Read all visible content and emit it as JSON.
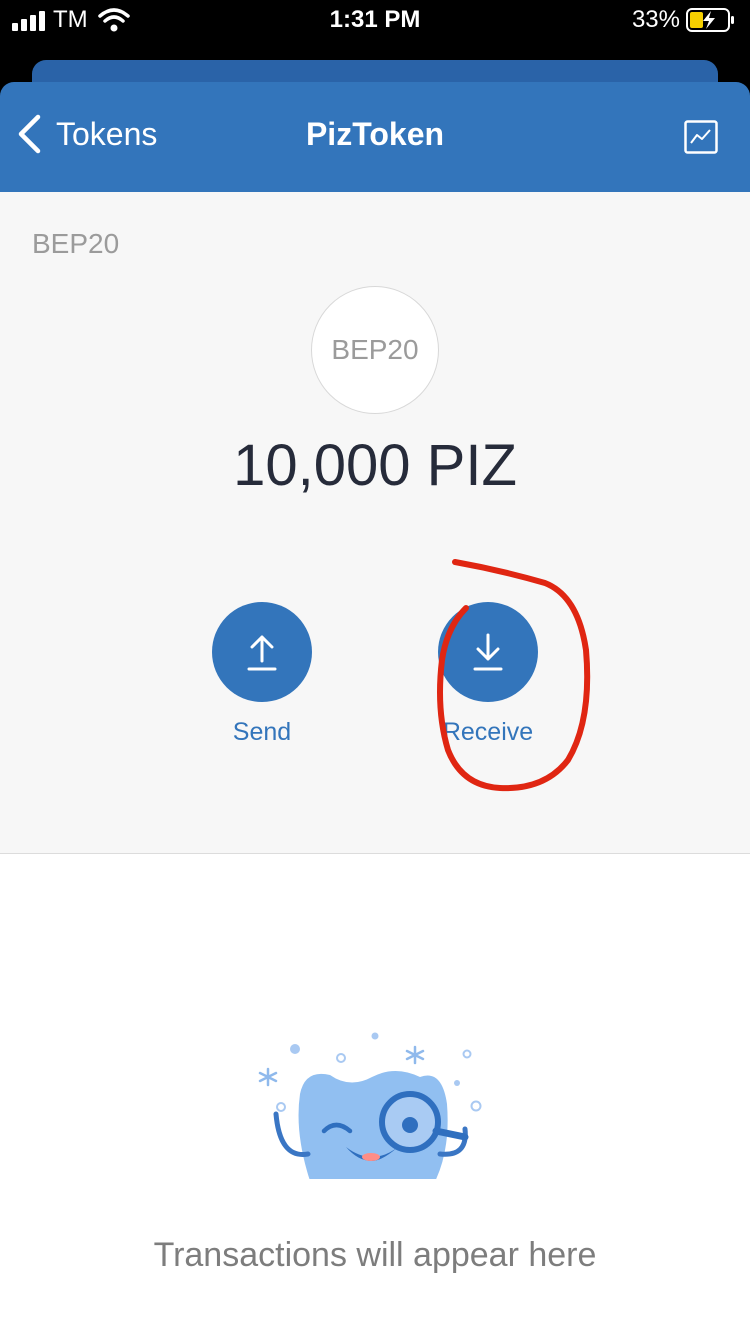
{
  "status_bar": {
    "carrier": "TM",
    "time": "1:31 PM",
    "battery": "33%"
  },
  "nav": {
    "back_label": "Tokens",
    "title": "PizToken",
    "chart_icon": "chart-icon"
  },
  "token": {
    "network": "BEP20",
    "logo_text": "BEP20",
    "balance": "10,000 PIZ"
  },
  "actions": {
    "send_label": "Send",
    "receive_label": "Receive"
  },
  "empty_state": {
    "message": "Transactions will appear here",
    "illustration": "mascot-magnifier-illustration"
  },
  "colors": {
    "brand": "#3375bb",
    "annotation": "#e02612"
  }
}
